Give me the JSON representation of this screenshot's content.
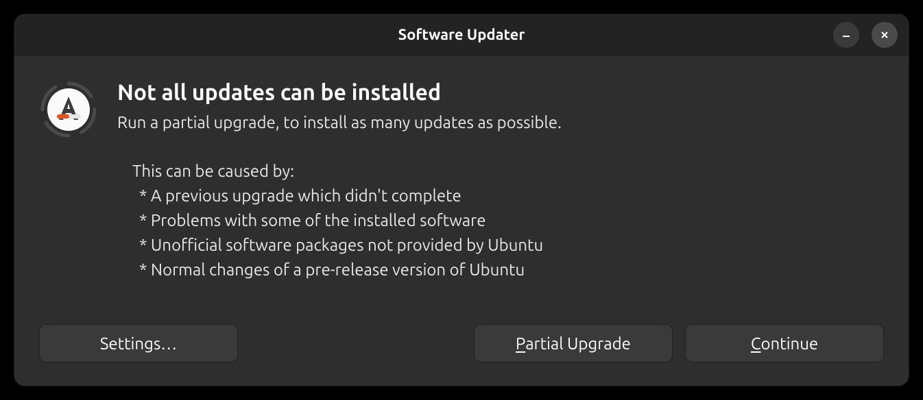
{
  "window": {
    "title": "Software Updater"
  },
  "content": {
    "heading": "Not all updates can be installed",
    "subheading": "Run a partial upgrade, to install as many updates as possible.",
    "causes_intro": "This can be caused by:",
    "causes": [
      " * A previous upgrade which didn't complete",
      " * Problems with some of the installed software",
      " * Unofficial software packages not provided by Ubuntu",
      " * Normal changes of a pre-release version of Ubuntu"
    ]
  },
  "buttons": {
    "settings": "Settings…",
    "partial_prefix": "",
    "partial_mnemonic": "P",
    "partial_suffix": "artial Upgrade",
    "continue_prefix": "",
    "continue_mnemonic": "C",
    "continue_suffix": "ontinue"
  }
}
